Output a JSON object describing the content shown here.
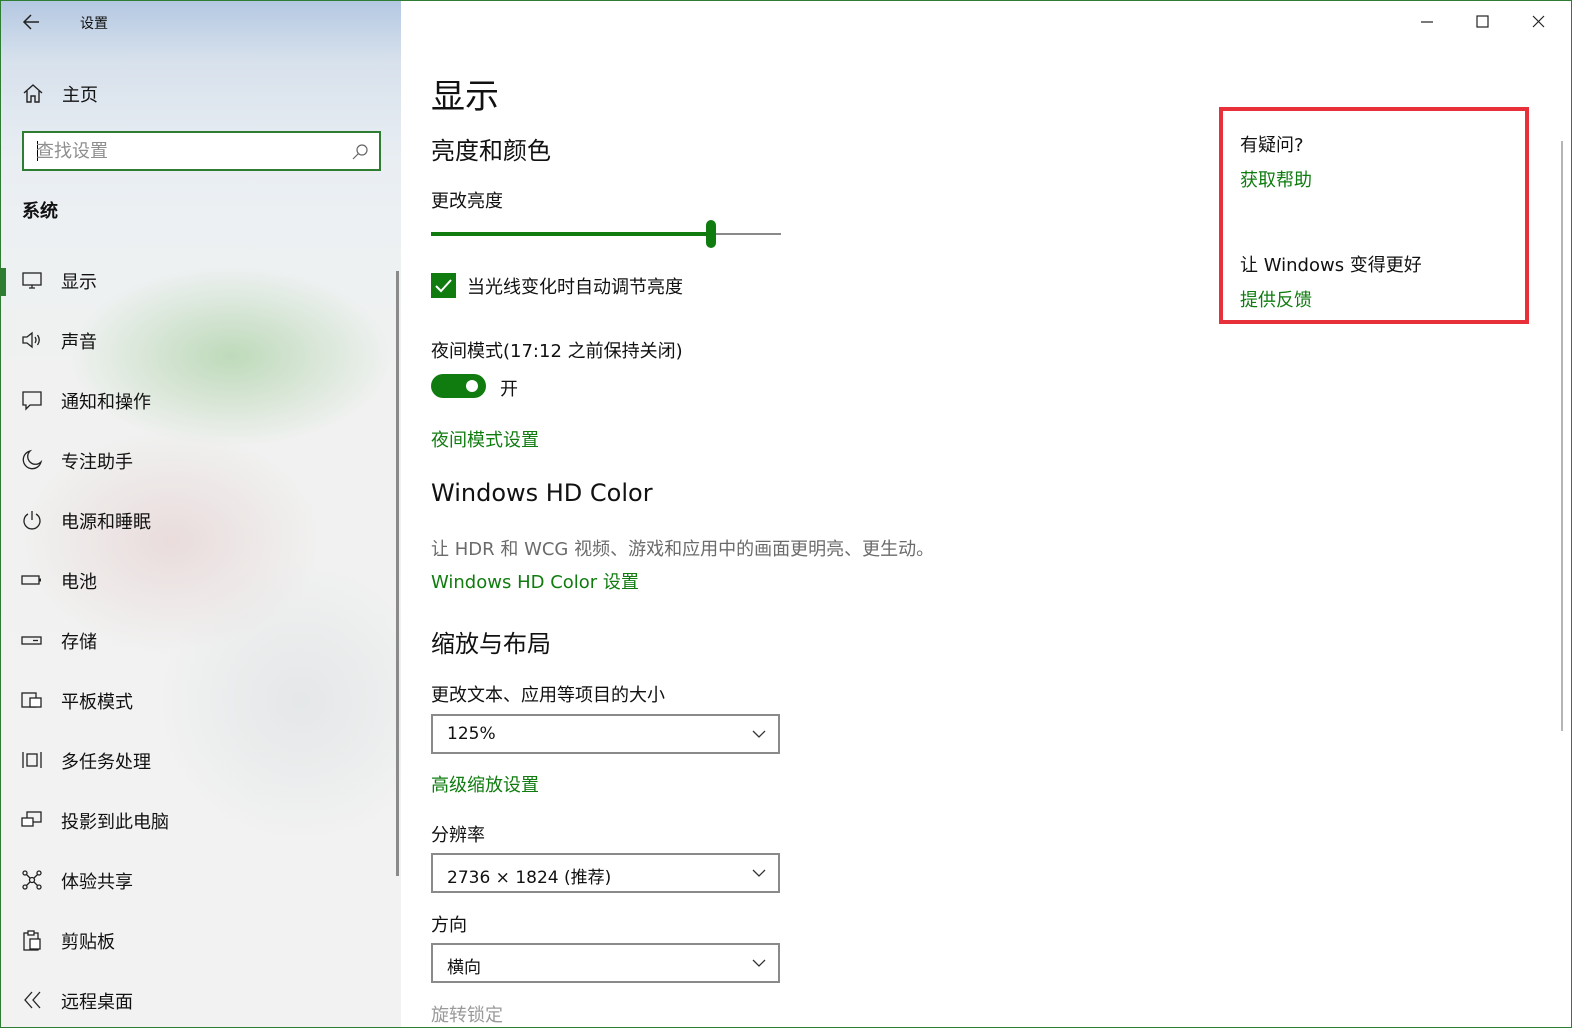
{
  "app": {
    "title": "设置"
  },
  "sidebar": {
    "home_label": "主页",
    "search_placeholder": "查找设置",
    "section_title": "系统",
    "items": [
      {
        "label": "显示",
        "icon": "monitor-icon",
        "selected": true
      },
      {
        "label": "声音",
        "icon": "speaker-icon"
      },
      {
        "label": "通知和操作",
        "icon": "notification-icon"
      },
      {
        "label": "专注助手",
        "icon": "moon-icon"
      },
      {
        "label": "电源和睡眠",
        "icon": "power-icon"
      },
      {
        "label": "电池",
        "icon": "battery-icon"
      },
      {
        "label": "存储",
        "icon": "storage-icon"
      },
      {
        "label": "平板模式",
        "icon": "tablet-mode-icon"
      },
      {
        "label": "多任务处理",
        "icon": "multitasking-icon"
      },
      {
        "label": "投影到此电脑",
        "icon": "project-icon"
      },
      {
        "label": "体验共享",
        "icon": "share-icon"
      },
      {
        "label": "剪贴板",
        "icon": "clipboard-icon"
      },
      {
        "label": "远程桌面",
        "icon": "remote-desktop-icon"
      }
    ]
  },
  "main": {
    "title": "显示",
    "brightness_section": {
      "heading": "亮度和颜色",
      "slider_label": "更改亮度",
      "brightness_level": 0.8,
      "auto_adjust_label": "当光线变化时自动调节亮度",
      "auto_adjust_checked": true
    },
    "night_light": {
      "label": "夜间模式(17:12 之前保持关闭)",
      "toggle_state": "开",
      "settings_link": "夜间模式设置"
    },
    "hdr": {
      "heading": "Windows HD Color",
      "description": "让 HDR 和 WCG 视频、游戏和应用中的画面更明亮、更生动。",
      "settings_link": "Windows HD Color 设置"
    },
    "scale_layout": {
      "heading": "缩放与布局",
      "scale_label": "更改文本、应用等项目的大小",
      "scale_value": "125%",
      "advanced_link": "高级缩放设置",
      "resolution_label": "分辨率",
      "resolution_value": "2736 × 1824 (推荐)",
      "orientation_label": "方向",
      "orientation_value": "横向",
      "rotation_lock_label": "旋转锁定"
    }
  },
  "help_panel": {
    "question": "有疑问?",
    "get_help": "获取帮助",
    "improve": "让 Windows 变得更好",
    "feedback": "提供反馈"
  },
  "colors": {
    "accent": "#107c10",
    "highlight_border": "#e8303a"
  }
}
